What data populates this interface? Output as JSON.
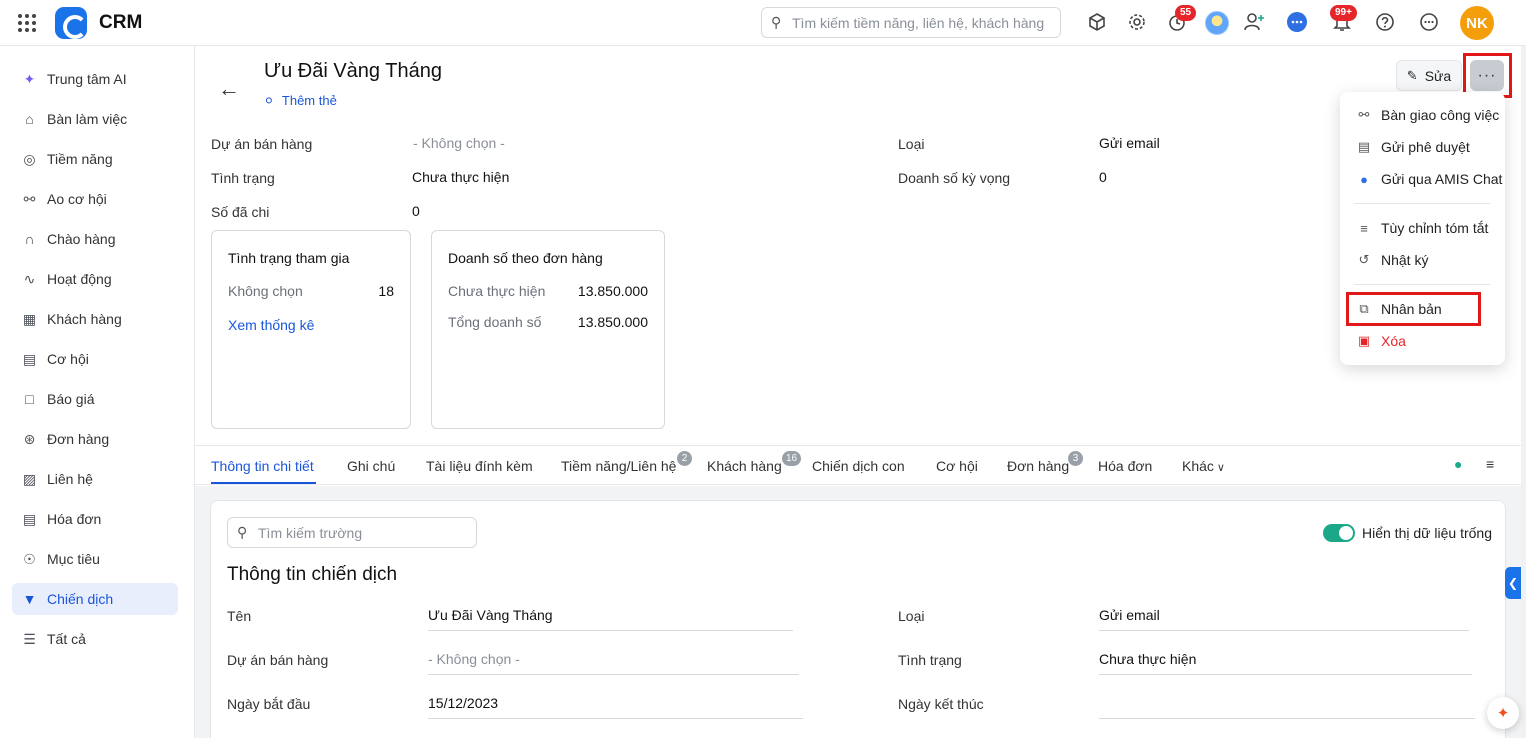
{
  "app": {
    "name": "CRM"
  },
  "topbar": {
    "search_placeholder": "Tìm kiếm tiềm năng, liên hệ, khách hàng",
    "timer_badge": "55",
    "notification_badge": "99+",
    "avatar_initials": "NK"
  },
  "sidebar": {
    "items": [
      {
        "label": "Trung tâm AI",
        "icon": "sparkle-icon"
      },
      {
        "label": "Bàn làm việc",
        "icon": "home-icon"
      },
      {
        "label": "Tiềm năng",
        "icon": "target-person-icon"
      },
      {
        "label": "Ao cơ hội",
        "icon": "users-icon"
      },
      {
        "label": "Chào hàng",
        "icon": "magnet-icon"
      },
      {
        "label": "Hoạt động",
        "icon": "activity-icon"
      },
      {
        "label": "Khách hàng",
        "icon": "building-icon"
      },
      {
        "label": "Cơ hội",
        "icon": "wallet-icon"
      },
      {
        "label": "Báo giá",
        "icon": "quote-icon"
      },
      {
        "label": "Đơn hàng",
        "icon": "cart-icon"
      },
      {
        "label": "Liên hệ",
        "icon": "contact-icon"
      },
      {
        "label": "Hóa đơn",
        "icon": "invoice-icon"
      },
      {
        "label": "Mục tiêu",
        "icon": "goal-icon"
      },
      {
        "label": "Chiến dịch",
        "icon": "megaphone-icon",
        "active": true
      },
      {
        "label": "Tất cả",
        "icon": "menu-icon"
      }
    ]
  },
  "header": {
    "title": "Ưu Đãi Vàng Tháng",
    "add_tag": "Thêm thẻ",
    "edit_label": "Sửa",
    "more_label": "···"
  },
  "summary": {
    "fields": [
      {
        "label": "Dự án bán hàng",
        "value": "- Không chọn -"
      },
      {
        "label": "Tình trạng",
        "value": "Chưa thực hiện"
      },
      {
        "label": "Số đã chi",
        "value": "0"
      },
      {
        "label": "Loại",
        "value": "Gửi email"
      },
      {
        "label": "Doanh số kỳ vọng",
        "value": "0"
      }
    ],
    "card_participation": {
      "title": "Tình trạng tham gia",
      "row_label": "Không chọn",
      "row_value": "18",
      "link": "Xem thống kê"
    },
    "card_sales": {
      "title": "Doanh số theo đơn hàng",
      "rows": [
        {
          "label": "Chưa thực hiện",
          "value": "13.850.000"
        },
        {
          "label": "Tổng doanh số",
          "value": "13.850.000"
        }
      ]
    }
  },
  "tabs": [
    {
      "label": "Thông tin chi tiết",
      "active": true
    },
    {
      "label": "Ghi chú"
    },
    {
      "label": "Tài liệu đính kèm"
    },
    {
      "label": "Tiềm năng/Liên hệ",
      "badge": "2"
    },
    {
      "label": "Khách hàng",
      "badge": "16"
    },
    {
      "label": "Chiến dịch con"
    },
    {
      "label": "Cơ hội"
    },
    {
      "label": "Đơn hàng",
      "badge": "3"
    },
    {
      "label": "Hóa đơn"
    },
    {
      "label": "Khác"
    }
  ],
  "detail": {
    "search_placeholder": "Tìm kiếm trường",
    "toggle_label": "Hiển thị dữ liệu trống",
    "toggle_on": true,
    "section_title": "Thông tin chiến dịch",
    "fields": [
      {
        "label": "Tên",
        "value": "Ưu Đãi Vàng Tháng"
      },
      {
        "label": "Dự án bán hàng",
        "value": "- Không chọn -"
      },
      {
        "label": "Ngày bắt đầu",
        "value": "15/12/2023"
      },
      {
        "label": "Loại",
        "value": "Gửi email"
      },
      {
        "label": "Tình trạng",
        "value": "Chưa thực hiện"
      },
      {
        "label": "Ngày kết thúc",
        "value": ""
      }
    ]
  },
  "more_menu": {
    "items": [
      {
        "label": "Bàn giao công việc",
        "icon": "handover-icon"
      },
      {
        "label": "Gửi phê duyệt",
        "icon": "approval-icon"
      },
      {
        "label": "Gửi qua AMIS Chat",
        "icon": "chat-icon"
      },
      {
        "label": "Tùy chỉnh tóm tắt",
        "icon": "sliders-icon"
      },
      {
        "label": "Nhật ký",
        "icon": "history-icon"
      },
      {
        "label": "Nhân bản",
        "icon": "copy-icon"
      },
      {
        "label": "Xóa",
        "icon": "trash-icon"
      }
    ]
  },
  "colors": {
    "accent": "#1a56db",
    "highlight": "#e01818",
    "danger": "#e5252a",
    "toggle": "#1aa889",
    "avatar": "#f59e0b"
  }
}
